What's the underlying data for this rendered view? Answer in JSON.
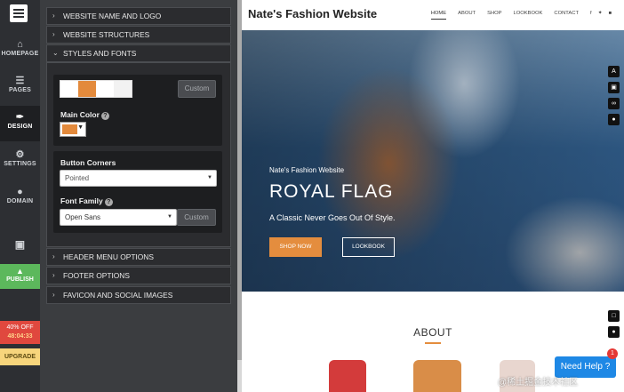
{
  "rail": {
    "items": [
      {
        "label": "HOMEPAGE",
        "icon": "home-icon"
      },
      {
        "label": "PAGES",
        "icon": "pages-icon"
      },
      {
        "label": "DESIGN",
        "icon": "brush-icon"
      },
      {
        "label": "SETTINGS",
        "icon": "gear-icon"
      },
      {
        "label": "DOMAIN",
        "icon": "globe-icon"
      }
    ],
    "publish": "PUBLISH",
    "promo_label": "40% OFF",
    "promo_timer": "48:04:33",
    "upgrade": "UPGRADE"
  },
  "panel": {
    "sections": {
      "name_logo": "WEBSITE NAME AND LOGO",
      "structures": "WEBSITE STRUCTURES",
      "styles": "STYLES AND FONTS",
      "header_menu": "HEADER MENU OPTIONS",
      "footer": "FOOTER OPTIONS",
      "favicon": "FAVICON AND SOCIAL IMAGES"
    },
    "palette_custom": "Custom",
    "main_color_label": "Main Color",
    "main_color": "#e38a3c",
    "button_corners_label": "Button Corners",
    "button_corners_value": "Pointed",
    "font_family_label": "Font Family",
    "font_family_value": "Open Sans",
    "font_custom": "Custom"
  },
  "site": {
    "brand": "Nate's Fashion Website",
    "nav": [
      "HOME",
      "ABOUT",
      "SHOP",
      "LOOKBOOK",
      "CONTACT"
    ],
    "hero_kicker": "Nate's Fashion Website",
    "hero_title": "ROYAL FLAG",
    "hero_sub": "A Classic Never Goes Out Of Style.",
    "btn_shop": "SHOP NOW",
    "btn_lookbook": "LOOKBOOK",
    "about": "ABOUT",
    "help": "Need Help ?",
    "help_count": "1",
    "watermark": "@稀土掘金技术社区"
  }
}
